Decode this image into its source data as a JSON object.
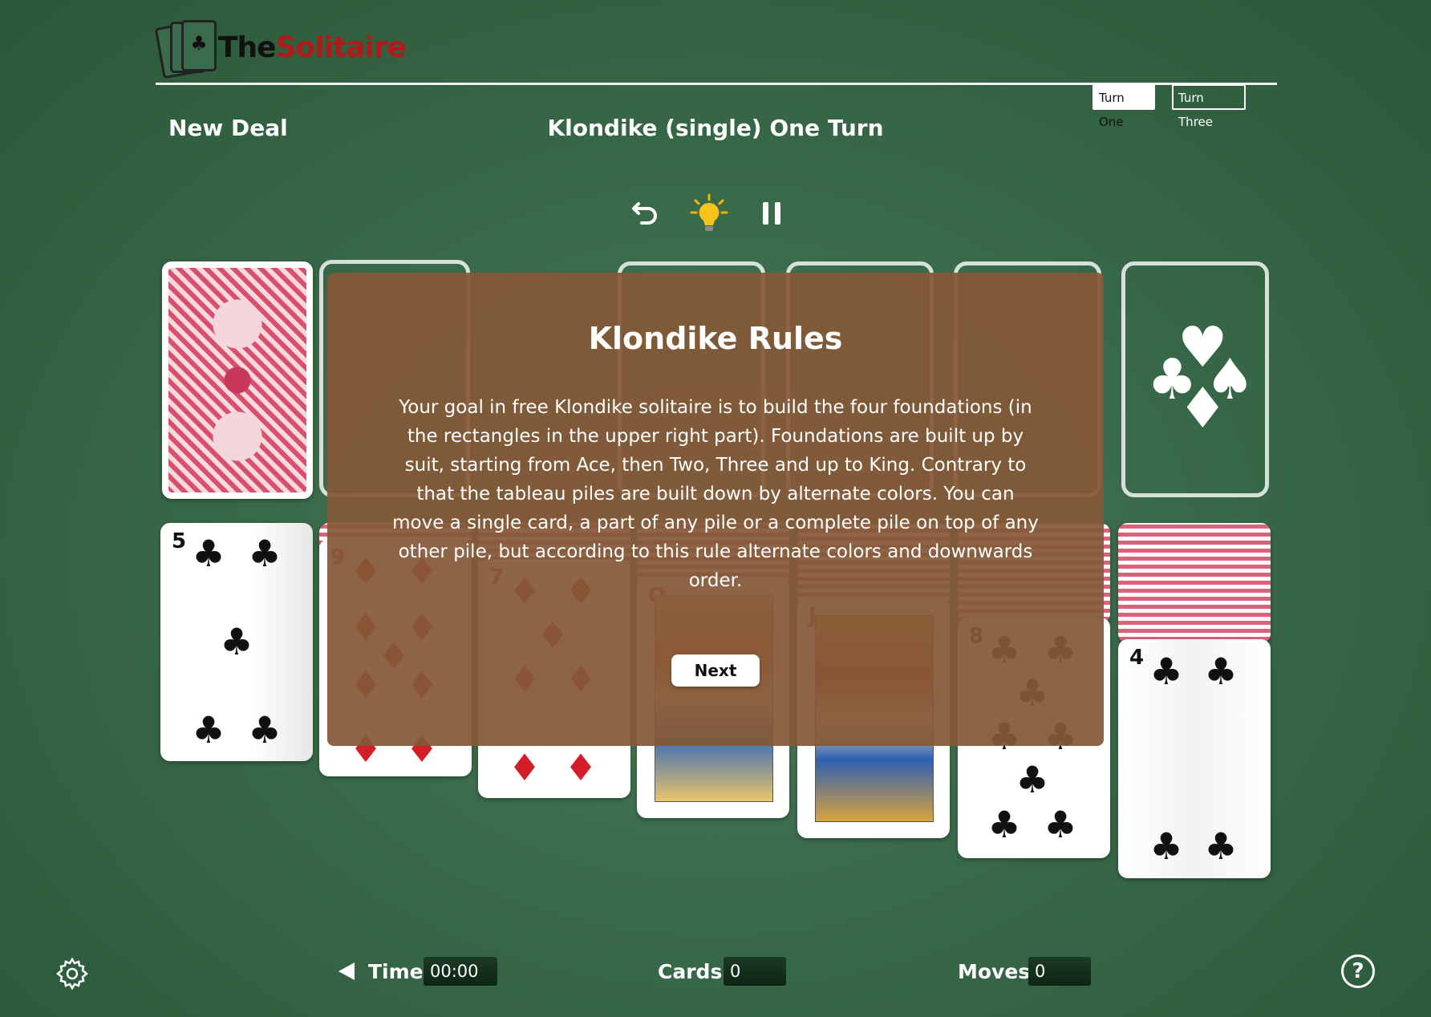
{
  "header": {
    "logo_the": "The",
    "logo_solitaire": "Solitaire",
    "turn_one": "Turn One",
    "turn_three": "Turn Three",
    "new_deal": "New Deal",
    "game_title": "Klondike (single) One Turn"
  },
  "toolbar": {
    "undo_icon": "undo-icon",
    "hint_icon": "lightbulb-icon",
    "pause_icon": "pause-icon"
  },
  "foundation_suits": "♣♥♠♦",
  "tableau": [
    {
      "rank": "5",
      "suit": "♣",
      "color": "black"
    },
    {
      "rank": "9",
      "suit": "♦",
      "color": "red"
    },
    {
      "rank": "7",
      "suit": "♦",
      "color": "red"
    },
    {
      "rank": "Q",
      "suit": "♦",
      "color": "red"
    },
    {
      "rank": "J",
      "suit": "♥",
      "color": "red"
    },
    {
      "rank": "8",
      "suit": "♣",
      "color": "black"
    },
    {
      "rank": "4",
      "suit": "♣",
      "color": "black"
    }
  ],
  "modal": {
    "title": "Klondike Rules",
    "body": "Your goal in free Klondike solitaire is to build the four foundations (in the rectangles in the upper right part). Foundations are built up by suit, starting from Ace, then Two, Three and up to King. Contrary to that the tableau piles are built down by alternate colors. You can move a single card, a part of any pile or a complete pile on top of any other pile, but according to this rule alternate colors and downwards order.",
    "next": "Next"
  },
  "footer": {
    "time_label": "Time:",
    "time_value": "00:00",
    "cards_label": "Cards:",
    "cards_value": "0",
    "moves_label": "Moves:",
    "moves_value": "0"
  },
  "colors": {
    "felt": "#3a6b4a",
    "logo_red": "#b21a1a",
    "modal_bg": "#845837",
    "card_back": "#d9506e"
  }
}
